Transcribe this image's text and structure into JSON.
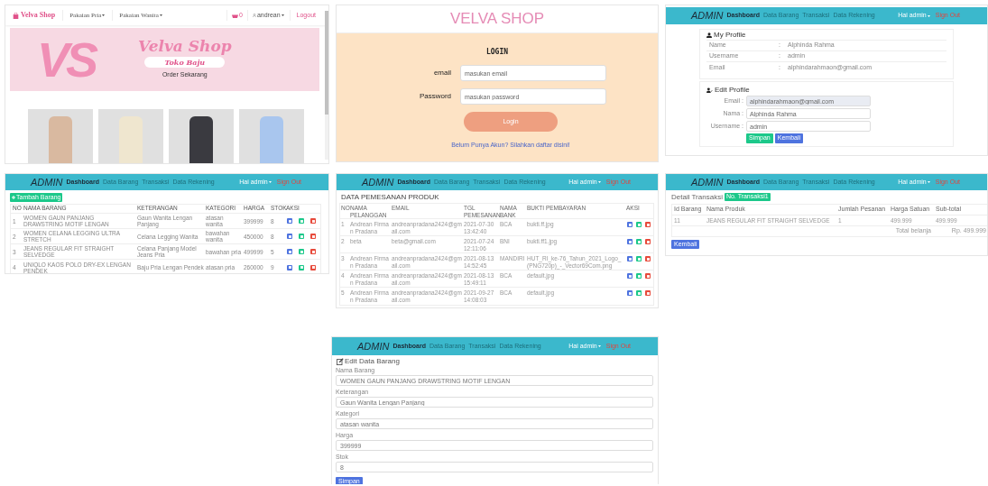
{
  "storefront": {
    "brand": "Velva Shop",
    "menus": [
      "Pakaian Pria",
      "Pakaian Wanita"
    ],
    "cart_count": "0",
    "user": "andrean",
    "logout": "Logout",
    "banner": {
      "logo": "VS",
      "title": "Velva Shop",
      "subtitle": "Toko Baju",
      "cta": "Order Sekarang"
    },
    "products": [
      {
        "color": "#d9b9a0"
      },
      {
        "color": "#efe6cf"
      },
      {
        "color": "#3a3a40"
      },
      {
        "color": "#a9c6ee"
      }
    ]
  },
  "login": {
    "shop_title": "VELVA SHOP",
    "heading": "LOGIN",
    "fields": [
      {
        "label": "email",
        "placeholder": "masukan email"
      },
      {
        "label": "Password",
        "placeholder": "masukan password"
      }
    ],
    "button": "Login",
    "link": "Belum Punya Akun? Silahkan daftar disini!"
  },
  "profile": {
    "nav": {
      "brand": "ADMIN",
      "links": [
        {
          "label": "Dashboard",
          "selected": true
        },
        {
          "label": "Data Barang",
          "selected": false
        },
        {
          "label": "Transaksi",
          "selected": false
        },
        {
          "label": "Data Rekening",
          "selected": false
        }
      ],
      "greeting": "Hai admin",
      "signout": "Sign Out"
    },
    "my_profile": {
      "title": "My Profile",
      "rows": [
        {
          "label": "Name",
          "separator": ":",
          "value": "Alphinda Rahma"
        },
        {
          "label": "Username",
          "separator": ":",
          "value": "admin"
        },
        {
          "label": "Email",
          "separator": ":",
          "value": "alphindarahmaon@gmail.com"
        }
      ]
    },
    "edit_profile": {
      "title": "Edit Profile",
      "fields": [
        {
          "label": "Email :",
          "value": "alphindarahmaon@gmail.com",
          "disabled": true
        },
        {
          "label": "Nama :",
          "value": "Alphinda Rahma",
          "disabled": false
        },
        {
          "label": "Username :",
          "value": "admin",
          "disabled": false
        }
      ],
      "buttons": [
        "Simpan",
        "Kembali"
      ]
    }
  },
  "barang": {
    "nav": {
      "brand": "ADMIN",
      "links": [
        {
          "label": "Dashboard",
          "selected": true
        },
        {
          "label": "Data Barang",
          "selected": false
        },
        {
          "label": "Transaksi",
          "selected": false
        },
        {
          "label": "Data Rekening",
          "selected": false
        }
      ],
      "greeting": "Hai admin",
      "signout": "Sign Out"
    },
    "add_button": "Tambah Barang",
    "columns": [
      "NO",
      "NAMA BARANG",
      "KETERANGAN",
      "KATEGORI",
      "HARGA",
      "STOK",
      "AKSI"
    ],
    "rows": [
      [
        "1",
        "WOMEN GAUN PANJANG DRAWSTRING MOTIF LENGAN",
        "Gaun Wanita Lengan Panjang",
        "atasan wanita",
        "399999",
        "8"
      ],
      [
        "2",
        "WOMEN CELANA LEGGING ULTRA STRETCH",
        "Celana Legging Wanita",
        "bawahan wanita",
        "450000",
        "8"
      ],
      [
        "3",
        "JEANS REGULAR FIT STRAIGHT SELVEDGE",
        "Celana Panjang Model Jeans Pria",
        "bawahan pria",
        "499999",
        "5"
      ],
      [
        "4",
        "UNIQLO KAOS POLO DRY-EX LENGAN PENDEK",
        "Baju Pria Lengan Pendek",
        "atasan pria",
        "260000",
        "9"
      ]
    ]
  },
  "pesanan": {
    "nav": {
      "brand": "ADMIN",
      "links": [
        {
          "label": "Dashboard",
          "selected": true
        },
        {
          "label": "Data Barang",
          "selected": false
        },
        {
          "label": "Transaksi",
          "selected": false
        },
        {
          "label": "Data Rekening",
          "selected": false
        }
      ],
      "greeting": "Hai admin",
      "signout": "Sign Out"
    },
    "title": "DATA PEMESANAN PRODUK",
    "columns": [
      "NO",
      "NAMA PELANGGAN",
      "EMAIL",
      "TGL PEMESANAN",
      "NAMA BANK",
      "BUKTI PEMBAYARAN",
      "AKSI"
    ],
    "rows": [
      [
        "1",
        "Andrean Firman Pradana",
        "andreanpradana2424@gmail.com",
        "2021-07-30 13:42:40",
        "BCA",
        "bukti.ff.jpg"
      ],
      [
        "2",
        "beta",
        "beta@gmail.com",
        "2021-07-24 12:11:06",
        "BNI",
        "bukti.ff1.jpg"
      ],
      [
        "3",
        "Andrean Firman Pradana",
        "andreanpradana2424@gmail.com",
        "2021-08-13 14:52:45",
        "MANDIRI",
        "HUT_RI_ke-76_Tahun_2021_Logo_(PNG720p)_-_Vector69Com.png"
      ],
      [
        "4",
        "Andrean Firman Pradana",
        "andreanpradana2424@gmail.com",
        "2021-08-13 15:49:11",
        "BCA",
        "default.jpg"
      ],
      [
        "5",
        "Andrean Firman Pradana",
        "andreanpradana2424@gmail.com",
        "2021-09-27 14:08:03",
        "BCA",
        "default.jpg"
      ]
    ]
  },
  "detail": {
    "nav": {
      "brand": "ADMIN",
      "links": [
        {
          "label": "Dashboard",
          "selected": true
        },
        {
          "label": "Data Barang",
          "selected": false
        },
        {
          "label": "Transaksi",
          "selected": false
        },
        {
          "label": "Data Rekening",
          "selected": false
        }
      ],
      "greeting": "Hai admin",
      "signout": "Sign Out"
    },
    "title": "Detail Transaksi",
    "badge": "No. Transaksi1",
    "columns": [
      "Id Barang",
      "Nama Produk",
      "Jumlah Pesanan",
      "Harga Satuan",
      "Sub-total"
    ],
    "rows": [
      [
        "11",
        "JEANS REGULAR FIT STRAIGHT SELVEDGE",
        "1",
        "499.999",
        "499.999"
      ]
    ],
    "total_label": "Total belanja",
    "total": "Rp. 499.999",
    "button": "Kembali"
  },
  "edit_barang": {
    "nav": {
      "brand": "ADMIN",
      "links": [
        {
          "label": "Dashboard",
          "selected": true
        },
        {
          "label": "Data Barang",
          "selected": false
        },
        {
          "label": "Transaksi",
          "selected": false
        },
        {
          "label": "Data Rekening",
          "selected": false
        }
      ],
      "greeting": "Hai admin",
      "signout": "Sign Out"
    },
    "title": "Edit Data Barang",
    "fields": [
      {
        "label": "Nama Barang",
        "value": "WOMEN GAUN PANJANG DRAWSTRING MOTIF LENGAN"
      },
      {
        "label": "Keterangan",
        "value": "Gaun Wanita Lengan Panjang"
      },
      {
        "label": "Kategori",
        "value": "atasan wanita"
      },
      {
        "label": "Harga",
        "value": "399999"
      },
      {
        "label": "Stok",
        "value": "8"
      }
    ],
    "button": "Simpan"
  }
}
